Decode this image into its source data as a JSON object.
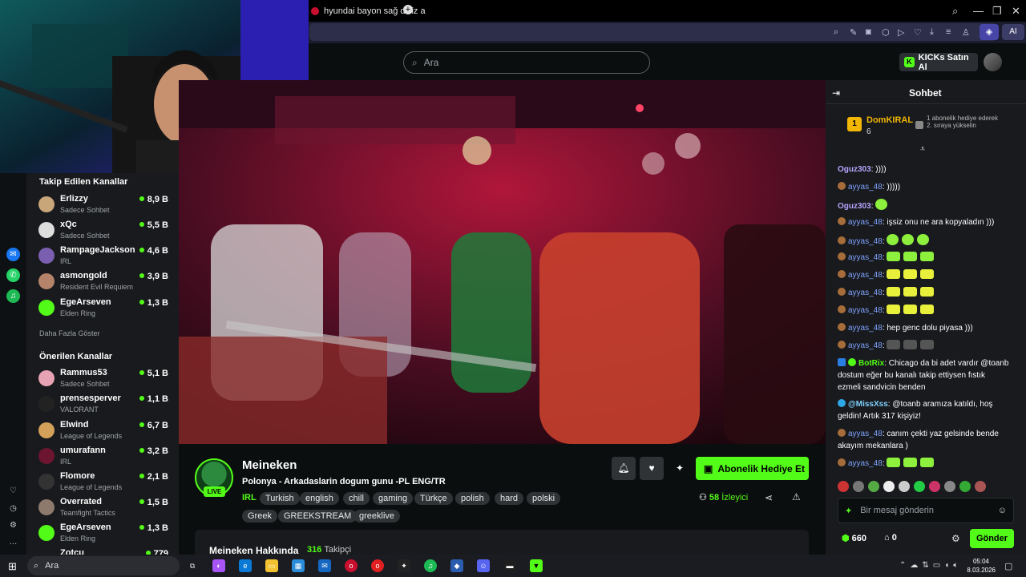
{
  "browser": {
    "tab_title": "hyundai bayon sağ dikiz a",
    "ai_label": "AI"
  },
  "header": {
    "search_placeholder": "Ara",
    "buy_kicks": "KICKs Satın Al"
  },
  "sidebar": {
    "followed_title": "Takip Edilen Kanallar",
    "followed": [
      {
        "name": "Erlizzy",
        "category": "Sadece Sohbet",
        "viewers": "8,9 B"
      },
      {
        "name": "xQc",
        "category": "Sadece Sohbet",
        "viewers": "5,5 B"
      },
      {
        "name": "RampageJackson",
        "category": "IRL",
        "viewers": "4,6 B"
      },
      {
        "name": "asmongold",
        "category": "Resident Evil Requiem",
        "viewers": "3,9 B"
      },
      {
        "name": "EgeArseven",
        "category": "Elden Ring",
        "viewers": "1,3 B"
      }
    ],
    "show_more": "Daha Fazla Göster",
    "recommended_title": "Önerilen Kanallar",
    "recommended": [
      {
        "name": "Rammus53",
        "category": "Sadece Sohbet",
        "viewers": "5,1 B"
      },
      {
        "name": "prensesperver",
        "category": "VALORANT",
        "viewers": "1,1 B"
      },
      {
        "name": "Elwind",
        "category": "League of Legends",
        "viewers": "6,7 B"
      },
      {
        "name": "umurafann",
        "category": "IRL",
        "viewers": "3,2 B"
      },
      {
        "name": "Flomore",
        "category": "League of Legends",
        "viewers": "2,1 B"
      },
      {
        "name": "Overrated",
        "category": "Teamfight Tactics",
        "viewers": "1,5 B"
      },
      {
        "name": "EgeArseven",
        "category": "Elden Ring",
        "viewers": "1,3 B"
      },
      {
        "name": "Zotcu",
        "category": "",
        "viewers": "779"
      }
    ]
  },
  "stream": {
    "name": "Meineken",
    "live": "LIVE",
    "title": "Polonya - Arkadaslarin dogum gunu -PL ENG/TR",
    "category": "IRL",
    "tags": [
      "Turkish",
      "english",
      "chill",
      "gaming",
      "Türkçe",
      "polish",
      "hard",
      "polski",
      "Greek",
      "GREEKSTREAM",
      "greeklive"
    ],
    "gift_button": "Abonelik Hediye Et",
    "viewer_count": "58",
    "viewer_label": "İzleyici",
    "about_title": "Meineken Hakkında",
    "followers_count": "316",
    "followers_label": "Takipçi"
  },
  "chat": {
    "title": "Sohbet",
    "pinned": {
      "rank": "1",
      "user": "DomKIRAL",
      "count": "6",
      "text": "1 abonelik hediye ederek 2. sıraya yükselin"
    },
    "messages": [
      {
        "user": "Oguz303",
        "text": ": ))))"
      },
      {
        "user": "ayyas_48",
        "text": ": )))))"
      },
      {
        "user": "Oguz303",
        "text": ":"
      },
      {
        "user": "ayyas_48",
        "text": ": işsiz onu ne ara kopyaladın )))"
      },
      {
        "user": "ayyas_48",
        "text": ":"
      },
      {
        "user": "ayyas_48",
        "text": ":"
      },
      {
        "user": "ayyas_48",
        "text": ":"
      },
      {
        "user": "ayyas_48",
        "text": ":"
      },
      {
        "user": "ayyas_48",
        "text": ":"
      },
      {
        "user": "ayyas_48",
        "text": ": hep genc dolu piyasa )))"
      },
      {
        "user": "ayyas_48",
        "text": ":"
      },
      {
        "user": "BotRix",
        "text": ": Chicago da bi adet vardır @toanb dostum eğer bu kanalı takip ettiysen fıstık ezmeli sandvicin benden"
      },
      {
        "user": "@MissXss",
        "text": ": @toanb aramıza katıldı, hoş geldin! Artık 317 kişiyiz!"
      },
      {
        "user": "ayyas_48",
        "text": ": canım çekti yaz gelsinde bende akayım mekanlara )"
      },
      {
        "user": "ayyas_48",
        "text": ":"
      }
    ],
    "input_placeholder": "Bir mesaj gönderin",
    "kicks": "660",
    "points": "0",
    "send": "Gönder"
  },
  "taskbar": {
    "search": "Ara",
    "time": "05:04",
    "date": "8.03.2026"
  },
  "colors": {
    "accent": "#53fc18",
    "sidebar_bg": "#181a1d",
    "page_bg": "#0b0e0f"
  }
}
